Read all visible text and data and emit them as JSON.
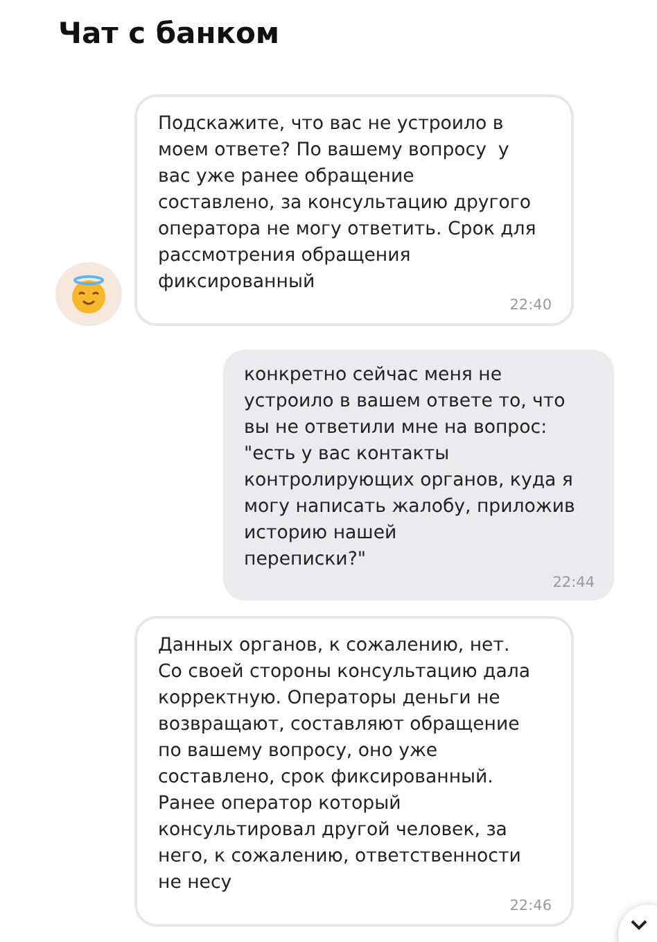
{
  "title": "Чат с банком",
  "messages": [
    {
      "kind": "incoming",
      "has_avatar": true,
      "text": "Подскажите, что вас не устроило в\nмоем ответе? По вашему вопросу  у\nвас уже ранее обращение\nсоставлено, за консультацию другого\nоператора не могу ответить. Срок для\nрассмотрения обращения\nфиксированный",
      "time": "22:40"
    },
    {
      "kind": "outgoing",
      "text": "конкретно сейчас меня не\nустроило в вашем ответе то, что\nвы не ответили мне на вопрос:\n\"есть у вас контакты\nконтролирующих органов, куда я\nмогу написать жалобу, приложив\nисторию нашей\nпереписки?\"",
      "time": "22:44"
    },
    {
      "kind": "incoming",
      "has_avatar": false,
      "text": "Данных органов, к сожалению, нет.\nСо своей стороны консультацию дала\nкорректную. Операторы деньги не\nвозвращают, составляют обращение\nпо вашему вопросу, оно уже\nсоставлено, срок фиксированный.\nРанее оператор который\nконсультировал другой человек, за\nнего, к сожалению, ответственности\nне несу",
      "time": "22:46"
    }
  ]
}
